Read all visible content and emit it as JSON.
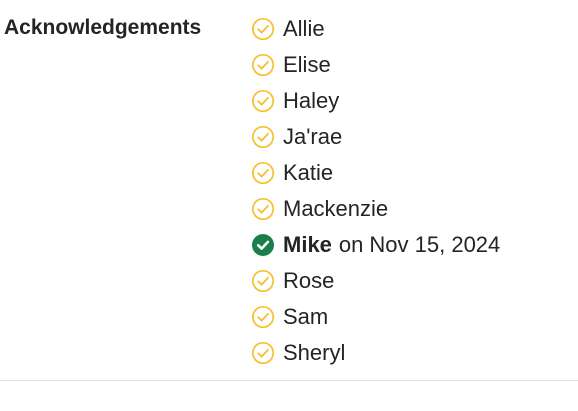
{
  "acknowledgements": {
    "label": "Acknowledgements",
    "colors": {
      "pending": "#F7C02C",
      "done": "#1A7F4B"
    },
    "items": [
      {
        "name": "Allie",
        "status": "pending",
        "icon": "pending-check-circle-icon"
      },
      {
        "name": "Elise",
        "status": "pending",
        "icon": "pending-check-circle-icon"
      },
      {
        "name": "Haley",
        "status": "pending",
        "icon": "pending-check-circle-icon"
      },
      {
        "name": "Ja'rae",
        "status": "pending",
        "icon": "pending-check-circle-icon"
      },
      {
        "name": "Katie",
        "status": "pending",
        "icon": "pending-check-circle-icon"
      },
      {
        "name": "Mackenzie",
        "status": "pending",
        "icon": "pending-check-circle-icon"
      },
      {
        "name": "Mike",
        "status": "acknowledged",
        "icon": "acknowledged-check-circle-icon",
        "date_prefix": "on",
        "date": "Nov 15, 2024"
      },
      {
        "name": "Rose",
        "status": "pending",
        "icon": "pending-check-circle-icon"
      },
      {
        "name": "Sam",
        "status": "pending",
        "icon": "pending-check-circle-icon"
      },
      {
        "name": "Sheryl",
        "status": "pending",
        "icon": "pending-check-circle-icon"
      }
    ]
  }
}
